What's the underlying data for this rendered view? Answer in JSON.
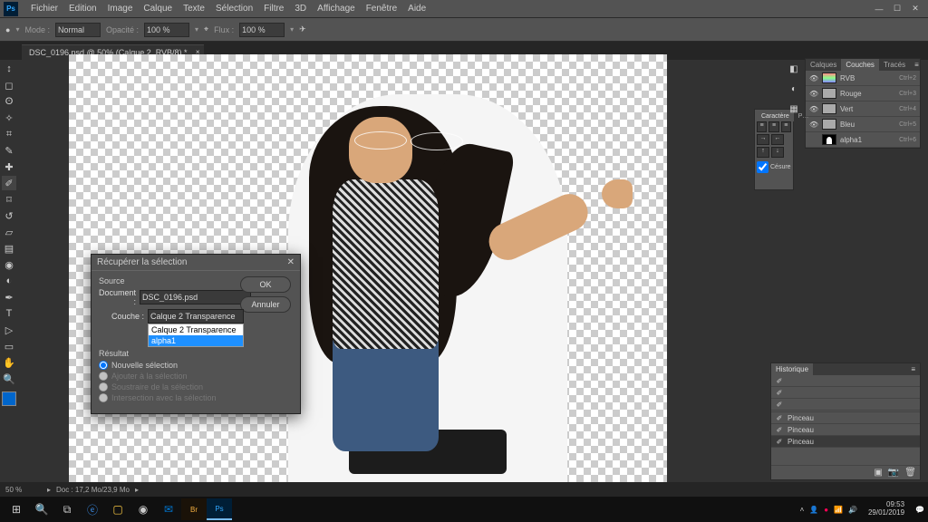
{
  "menu": {
    "items": [
      "Fichier",
      "Edition",
      "Image",
      "Calque",
      "Texte",
      "Sélection",
      "Filtre",
      "3D",
      "Affichage",
      "Fenêtre",
      "Aide"
    ]
  },
  "options": {
    "mode_label": "Mode :",
    "mode_value": "Normal",
    "opacity_label": "Opacité :",
    "opacity_value": "100 %",
    "flux_label": "Flux :",
    "flux_value": "100 %"
  },
  "document": {
    "tab_title": "DSC_0196.psd @ 50% (Calque 2, RVB/8) *"
  },
  "status": {
    "zoom": "50 %",
    "info": "Doc : 17,2 Mo/23,9 Mo"
  },
  "dialog": {
    "title": "Récupérer la sélection",
    "ok": "OK",
    "cancel": "Annuler",
    "source_label": "Source",
    "document_label": "Document :",
    "document_value": "DSC_0196.psd",
    "couche_label": "Couche :",
    "couche_value": "Calque 2 Transparence",
    "dropdown": {
      "opt1": "Calque 2 Transparence",
      "opt2": "alpha1"
    },
    "result_label": "Résultat",
    "r1": "Nouvelle sélection",
    "r2": "Ajouter à la sélection",
    "r3": "Soustraire de la sélection",
    "r4": "Intersection avec la sélection"
  },
  "panels": {
    "layers_tab": "Calques",
    "channels_tab": "Couches",
    "paths_tab": "Tracés",
    "history_tab": "Historique",
    "char_tab": "Caractère",
    "para_tab": "P…",
    "cesure": "Césure"
  },
  "channels": [
    {
      "name": "RVB",
      "sc": "Ctrl+2",
      "cls": "rgb"
    },
    {
      "name": "Rouge",
      "sc": "Ctrl+3",
      "cls": "red"
    },
    {
      "name": "Vert",
      "sc": "Ctrl+4",
      "cls": "red"
    },
    {
      "name": "Bleu",
      "sc": "Ctrl+5",
      "cls": "red"
    },
    {
      "name": "alpha1",
      "sc": "Ctrl+6",
      "cls": "alpha"
    }
  ],
  "history": {
    "item": "Pinceau"
  },
  "taskbar": {
    "time": "09:53",
    "date": "29/01/2019"
  }
}
